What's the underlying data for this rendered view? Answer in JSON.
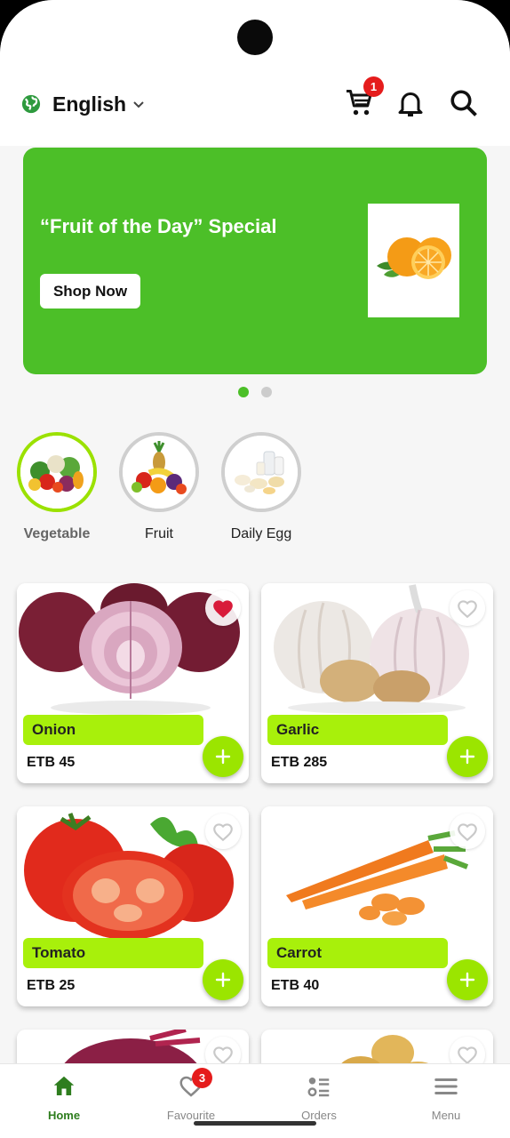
{
  "header": {
    "language": "English",
    "cart_count": "1"
  },
  "banner": {
    "title": "“Fruit of the Day” Special",
    "button": "Shop Now"
  },
  "categories": [
    {
      "name": "Vegetable"
    },
    {
      "name": "Fruit"
    },
    {
      "name": "Daily Egg"
    }
  ],
  "products": [
    {
      "name": "Onion",
      "price": "ETB 45"
    },
    {
      "name": "Garlic",
      "price": "ETB 285"
    },
    {
      "name": "Tomato",
      "price": "ETB 25"
    },
    {
      "name": "Carrot",
      "price": "ETB 40"
    }
  ],
  "nav": {
    "home": "Home",
    "favourite": "Favourite",
    "favourite_count": "3",
    "orders": "Orders",
    "menu": "Menu"
  },
  "colors": {
    "brand_green": "#4cbf28",
    "accent_lime": "#a8f00b",
    "badge_red": "#e51c1c"
  }
}
